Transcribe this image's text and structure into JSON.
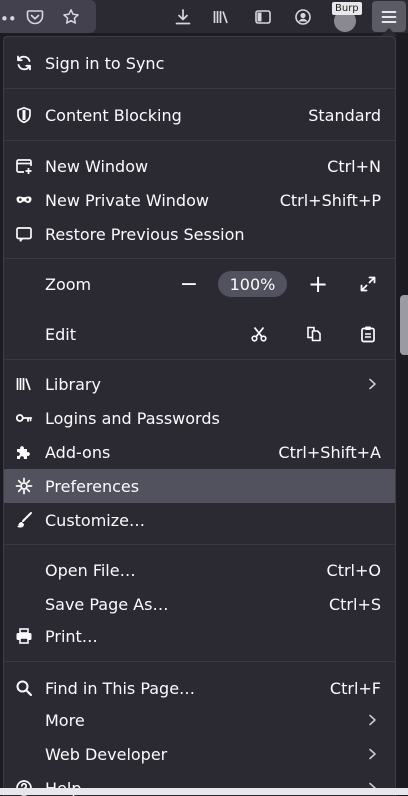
{
  "toolbar": {
    "overflow": "••",
    "burp_label": "Burp",
    "icons": [
      "pocket-icon",
      "bookmark-star-icon",
      "download-icon",
      "library-icon",
      "sidebar-icon",
      "account-icon",
      "burp-extension-icon",
      "hamburger-menu-icon"
    ]
  },
  "menu": {
    "sync": "Sign in to Sync",
    "content_blocking": {
      "label": "Content Blocking",
      "value": "Standard"
    },
    "new_window": {
      "label": "New Window",
      "shortcut": "Ctrl+N"
    },
    "new_private_window": {
      "label": "New Private Window",
      "shortcut": "Ctrl+Shift+P"
    },
    "restore_session": "Restore Previous Session",
    "zoom": {
      "label": "Zoom",
      "value": "100%",
      "minus": "−",
      "plus": "+"
    },
    "edit": {
      "label": "Edit"
    },
    "library": "Library",
    "logins": "Logins and Passwords",
    "addons": {
      "label": "Add-ons",
      "shortcut": "Ctrl+Shift+A"
    },
    "preferences": "Preferences",
    "customize": "Customize…",
    "open_file": {
      "label": "Open File…",
      "shortcut": "Ctrl+O"
    },
    "save_page": {
      "label": "Save Page As…",
      "shortcut": "Ctrl+S"
    },
    "print": "Print…",
    "find": {
      "label": "Find in This Page…",
      "shortcut": "Ctrl+F"
    },
    "more": "More",
    "web_developer": "Web Developer",
    "help": "Help"
  },
  "colors": {
    "panel_bg": "#2b2a33",
    "highlight": "#52525e",
    "text": "#fbfbfe"
  }
}
